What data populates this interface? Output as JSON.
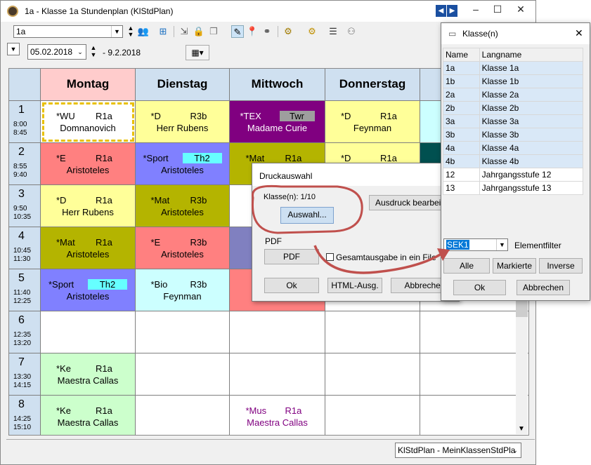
{
  "window": {
    "title": "1a - Klasse 1a  Stundenplan  (KlStdPlan)"
  },
  "toolbar": {
    "class_value": "1a"
  },
  "datebar": {
    "date_from": "05.02.2018",
    "date_to": "- 9.2.2018"
  },
  "timetable": {
    "days": [
      "Montag",
      "Dienstag",
      "Mittwoch",
      "Donnerstag"
    ],
    "periods": [
      {
        "num": "1",
        "start": "8:00",
        "end": "8:45"
      },
      {
        "num": "2",
        "start": "8:55",
        "end": "9:40"
      },
      {
        "num": "3",
        "start": "9:50",
        "end": "10:35"
      },
      {
        "num": "4",
        "start": "10:45",
        "end": "11:30"
      },
      {
        "num": "5",
        "start": "11:40",
        "end": "12:25"
      },
      {
        "num": "6",
        "start": "12:35",
        "end": "13:20"
      },
      {
        "num": "7",
        "start": "13:30",
        "end": "14:15"
      },
      {
        "num": "8",
        "start": "14:25",
        "end": "15:10"
      }
    ],
    "lessons": [
      {
        "subject": "*WU",
        "room": "R1a",
        "teacher": "Domnanovich"
      },
      {
        "subject": "*D",
        "room": "R3b",
        "teacher": "Herr Rubens"
      },
      {
        "subject": "*TEX",
        "room": "Twr",
        "teacher": "Madame Curie"
      },
      {
        "subject": "*D",
        "room": "R1a",
        "teacher": "Feynman"
      },
      {
        "subject": "*E",
        "room": "R1a",
        "teacher": "Aristoteles"
      },
      {
        "subject": "*Sport",
        "room": "Th2",
        "teacher": "Aristoteles"
      },
      {
        "subject": "*Mat",
        "room": "R1a",
        "teacher": ""
      },
      {
        "subject": "*D",
        "room": "R1a",
        "teacher": ""
      },
      {
        "subject": "*D",
        "room": "R1a",
        "teacher": "Herr Rubens"
      },
      {
        "subject": "*Mat",
        "room": "R3b",
        "teacher": "Aristoteles"
      },
      {
        "subject": "*Mat",
        "room": "R1a",
        "teacher": "Aristoteles"
      },
      {
        "subject": "*E",
        "room": "R3b",
        "teacher": "Aristoteles"
      },
      {
        "subject": "*Sport",
        "room": "Th2",
        "teacher": "Aristoteles"
      },
      {
        "subject": "*Bio",
        "room": "R3b",
        "teacher": "Feynman"
      },
      {
        "subject": "*Ke",
        "room": "R1a",
        "teacher": "Maestra Callas"
      },
      {
        "subject": "*Ke",
        "room": "R1a",
        "teacher": "Maestra Callas"
      },
      {
        "subject": "*Mus",
        "room": "R1a",
        "teacher": "Maestra Callas"
      }
    ],
    "colors": {
      "header": "#cfe0f0",
      "montag_header": "#ffcccc",
      "yellow": "#ffff99",
      "purple": "#800080",
      "salmon": "#ff8080",
      "blue": "#8080ff",
      "olive": "#b4b400",
      "cyan": "#ccffff",
      "green": "#ccffcc"
    }
  },
  "statusbar": {
    "layout": "KlStdPlan - MeinKlassenStdPla"
  },
  "print_dialog": {
    "title": "Druckauswahl",
    "class_label": "Klasse(n): 1/10",
    "select_button": "Auswahl...",
    "edit_print_button": "Ausdruck bearbeiten",
    "pdf_group": "PDF",
    "pdf_button": "PDF",
    "single_file_checkbox": "Gesamtausgabe in ein File",
    "ok_button": "Ok",
    "html_button": "HTML-Ausg.",
    "cancel_button": "Abbrechen"
  },
  "class_dialog": {
    "title": "Klasse(n)",
    "columns": [
      "Name",
      "Langname"
    ],
    "rows": [
      {
        "name": "1a",
        "long": "Klasse 1a",
        "selected": true
      },
      {
        "name": "1b",
        "long": "Klasse 1b",
        "selected": true
      },
      {
        "name": "2a",
        "long": "Klasse 2a",
        "selected": true
      },
      {
        "name": "2b",
        "long": "Klasse 2b",
        "selected": true
      },
      {
        "name": "3a",
        "long": "Klasse 3a",
        "selected": true
      },
      {
        "name": "3b",
        "long": "Klasse 3b",
        "selected": true
      },
      {
        "name": "4a",
        "long": "Klasse 4a",
        "selected": true
      },
      {
        "name": "4b",
        "long": "Klasse 4b",
        "selected": true
      },
      {
        "name": "12",
        "long": "Jahrgangsstufe 12",
        "selected": false
      },
      {
        "name": "13",
        "long": "Jahrgangsstufe 13",
        "selected": false
      }
    ],
    "filter_value": "SEK1",
    "filter_label": "Elementfilter",
    "all_button": "Alle",
    "marked_button": "Markierte",
    "inverse_button": "Inverse",
    "ok_button": "Ok",
    "cancel_button": "Abbrechen"
  },
  "annotation": {
    "color": "#c0504d"
  }
}
